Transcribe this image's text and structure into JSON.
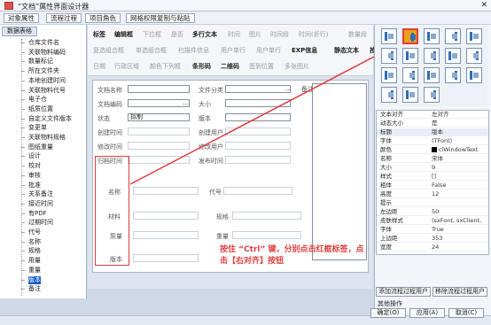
{
  "window": {
    "title": "“文档”属性界面设计器"
  },
  "menu": [
    "对象属性",
    "流程过程",
    "项目角色",
    "网格权限复制与粘贴"
  ],
  "tree": {
    "tab": "数据表格",
    "items": [
      "仓库文件名",
      "关联物料编码",
      "数量标记",
      "所在文件夹",
      "本地创建时间",
      "关联物料代号",
      "电子仓",
      "纸质位置",
      "自定义文件版本",
      "变更单",
      "关联物料规格",
      "图纸重量",
      "设计",
      "校对",
      "审核",
      "批准",
      "关系备注",
      "接近时间",
      "有PDF",
      "过期时间",
      "代号",
      "名称",
      "规格",
      "用量",
      "重量",
      "版本",
      "备注"
    ],
    "selected": 25
  },
  "toolbar": {
    "row1": [
      "标签",
      "编辑框",
      "下拉框",
      "是否",
      "多行文本",
      "时间",
      "图片",
      "时间段",
      "时间(折行)",
      "数量段"
    ],
    "row2": [
      "复选组合框",
      "单选组合框",
      "扫描件信息",
      "用户单行",
      "用户单行",
      "EXP信息",
      "静态文本",
      "按钮",
      "组合框"
    ],
    "row3": [
      "日期",
      "行政区域",
      "颜色下列框",
      "条形码",
      "二维码",
      "签到位置",
      "多张图片"
    ],
    "active": [
      "标签",
      "编辑框",
      "多行文本",
      "EXP信息",
      "静态文本",
      "按钮",
      "组合框",
      "条形码",
      "二维码"
    ]
  },
  "form": {
    "labels_left": [
      "文档名称",
      "文档编码",
      "状态",
      "创建时间",
      "修改时间",
      "归档时间"
    ],
    "labels_right": [
      "文件分类",
      "大小",
      "版本",
      "创建用户",
      "修改用户",
      "发布时间"
    ],
    "status_value": "拟制",
    "memo_label": "备注",
    "red_labels": [
      "名称",
      "材料",
      "质量",
      "版本"
    ],
    "red_right_labels": [
      "代号",
      "规格",
      "重量"
    ]
  },
  "instruction": "按住 “Ctrl” 键，分别点击红框标签，点击【右对齐】按钮",
  "properties": [
    {
      "name": "文本对齐",
      "value": "左对齐"
    },
    {
      "name": "动态大小",
      "value": "是"
    },
    {
      "name": "标题",
      "value": "版本"
    },
    {
      "name": "字体",
      "value": "(TFont)"
    },
    {
      "name": "颜色",
      "value": "clWindowText"
    },
    {
      "name": "名称",
      "value": "宋体"
    },
    {
      "name": "大小",
      "value": "9"
    },
    {
      "name": "样式",
      "value": "[]"
    },
    {
      "name": "粗体",
      "value": "False"
    },
    {
      "name": "高度",
      "value": "12"
    },
    {
      "name": "提示",
      "value": ""
    },
    {
      "name": "左边距",
      "value": "50"
    },
    {
      "name": "皮肤样式",
      "value": "(sxFont, sxClient,"
    },
    {
      "name": "字体",
      "value": "True"
    },
    {
      "name": "上边距",
      "value": "353"
    },
    {
      "name": "宽度",
      "value": "24"
    }
  ],
  "bottom": {
    "add_flow": "添加流程过程用户",
    "remove_flow": "移除流程过程用户",
    "other": "其他操作",
    "ok": "确定(O)",
    "apply": "应用(A)",
    "cancel": "取消(C)"
  },
  "colors": {
    "accent": "#0a58c8",
    "highlight": "#e23a3a",
    "button": "#e8a21a"
  }
}
